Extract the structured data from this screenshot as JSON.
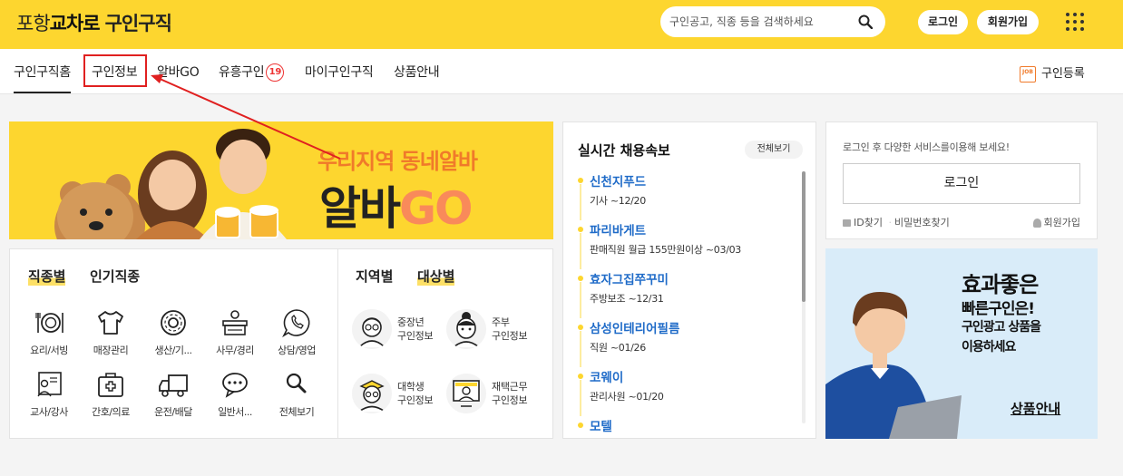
{
  "header": {
    "logo_part1": "포항",
    "logo_part2": "교차로",
    "logo_part3": "구인구직",
    "search_placeholder": "구인공고, 직종 등을 검색하세요",
    "login_label": "로그인",
    "join_label": "회원가입",
    "brand_color": "#fdd62f"
  },
  "nav": {
    "items": [
      {
        "label": "구인구직홈"
      },
      {
        "label": "구인정보"
      },
      {
        "label": "알바GO"
      },
      {
        "label": "유흥구인",
        "badge": "19"
      },
      {
        "label": "마이구인구직"
      },
      {
        "label": "상품안내"
      }
    ],
    "register_label": "구인등록",
    "register_icon_text": "JOB"
  },
  "banner": {
    "subtitle": "우리지역 동네알바",
    "title_part1": "알바",
    "title_part2": "GO"
  },
  "categories": {
    "tab_job": "직종별",
    "tab_popular": "인기직종",
    "tab_region": "지역별",
    "tab_target": "대상별",
    "jobs": [
      {
        "label": "요리/서빙",
        "icon": "dining-icon"
      },
      {
        "label": "매장관리",
        "icon": "shirt-icon"
      },
      {
        "label": "생산/기...",
        "icon": "gear-icon"
      },
      {
        "label": "사무/경리",
        "icon": "desk-icon"
      },
      {
        "label": "상담/영업",
        "icon": "phone-icon"
      },
      {
        "label": "교사/강사",
        "icon": "teacher-icon"
      },
      {
        "label": "간호/의료",
        "icon": "medical-kit-icon"
      },
      {
        "label": "운전/배달",
        "icon": "truck-icon"
      },
      {
        "label": "일반서...",
        "icon": "chat-icon"
      },
      {
        "label": "전체보기",
        "icon": "search-icon"
      }
    ],
    "targets": [
      {
        "line1": "중장년",
        "line2": "구인정보",
        "icon": "senior-man-icon"
      },
      {
        "line1": "주부",
        "line2": "구인정보",
        "icon": "housewife-icon"
      },
      {
        "line1": "대학생",
        "line2": "구인정보",
        "icon": "student-icon"
      },
      {
        "line1": "재택근무",
        "line2": "구인정보",
        "icon": "remote-worker-icon"
      }
    ]
  },
  "realtime": {
    "title": "실시간 채용속보",
    "view_all": "전체보기",
    "items": [
      {
        "name": "신천지푸드",
        "desc": "기사 ~12/20"
      },
      {
        "name": "파리바게트",
        "desc": "판매직원 월급 155만원이상 ~03/03"
      },
      {
        "name": "효자그집쭈꾸미",
        "desc": "주방보조 ~12/31"
      },
      {
        "name": "삼성인테리어필름",
        "desc": "직원 ~01/26"
      },
      {
        "name": "코웨이",
        "desc": "관리사원 ~01/20"
      },
      {
        "name": "모텔",
        "desc": ""
      }
    ]
  },
  "login_box": {
    "message": "로그인 후 다양한 서비스를이용해 보세요!",
    "button": "로그인",
    "find_id": "ID찾기",
    "find_pw": "비밀번호찾기",
    "join": "회원가입"
  },
  "ad": {
    "line1": "효과좋은",
    "line2": "빠른구인은!",
    "line3": "구인광고 상품을",
    "line4": "이용하세요",
    "link": "상품안내"
  }
}
